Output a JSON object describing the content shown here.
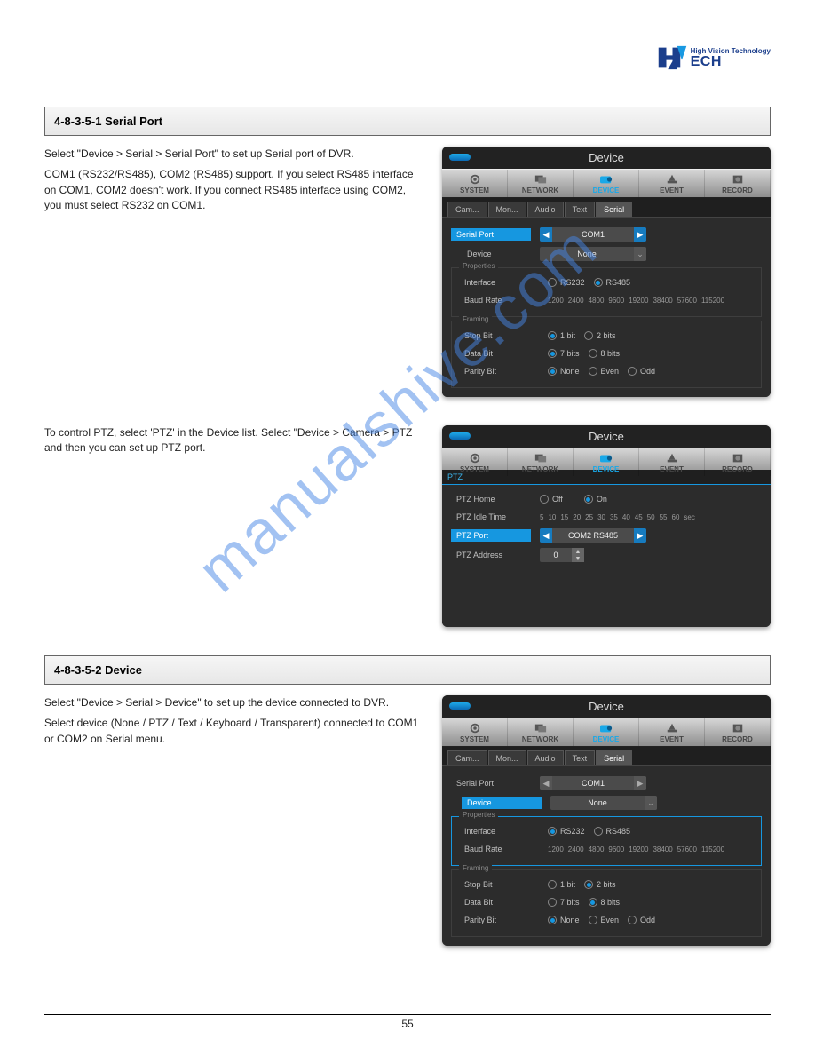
{
  "logo": {
    "tagline": "High Vision Technology",
    "brand": "ECH"
  },
  "section1": {
    "title": "4-8-3-5-1 Serial Port",
    "para1": "Select \"Device > Serial > Serial Port\" to set up Serial port of DVR.",
    "para2": "COM1 (RS232/RS485), COM2 (RS485) support. If you select RS485 interface on COM1, COM2 doesn't work. If you connect RS485 interface using COM2, you must select RS232 on COM1.",
    "para3": "To control PTZ, select 'PTZ' in the Device list. Select \"Device > Camera > PTZ and then you can set up PTZ port."
  },
  "section2": {
    "title": "4-8-3-5-2 Device",
    "para1": "Select \"Device > Serial > Device\" to set up the device connected to DVR.",
    "para2": "Select device (None / PTZ / Text / Keyboard / Transparent) connected to COM1 or COM2 on Serial menu."
  },
  "panel": {
    "title": "Device",
    "nav": [
      "SYSTEM",
      "NETWORK",
      "DEVICE",
      "EVENT",
      "RECORD"
    ],
    "tabs": [
      "Cam...",
      "Mon...",
      "Audio",
      "Text",
      "Serial"
    ],
    "serial": {
      "serialPortLabel": "Serial Port",
      "serialPortValue": "COM1",
      "deviceLabel": "Device",
      "deviceValue": "None",
      "propertiesLabel": "Properties",
      "interfaceLabel": "Interface",
      "interfaceOptions": [
        "RS232",
        "RS485"
      ],
      "baudLabel": "Baud Rate",
      "baudTicks": [
        "1200",
        "2400",
        "4800",
        "9600",
        "19200",
        "38400",
        "57600",
        "115200"
      ],
      "framingLabel": "Framing",
      "stopBitLabel": "Stop Bit",
      "stopBitOptions": [
        "1 bit",
        "2 bits"
      ],
      "dataBitLabel": "Data Bit",
      "dataBitOptions": [
        "7 bits",
        "8 bits"
      ],
      "parityLabel": "Parity Bit",
      "parityOptions": [
        "None",
        "Even",
        "Odd"
      ]
    },
    "ptz": {
      "head": "PTZ",
      "homeLabel": "PTZ Home",
      "homeOptions": [
        "Off",
        "On"
      ],
      "idleLabel": "PTZ Idle Time",
      "idleTicks": [
        "5",
        "10",
        "15",
        "20",
        "25",
        "30",
        "35",
        "40",
        "45",
        "50",
        "55",
        "60"
      ],
      "idleUnit": "sec",
      "portLabel": "PTZ Port",
      "portValue": "COM2 RS485",
      "addrLabel": "PTZ Address",
      "addrValue": "0"
    }
  },
  "footer": "55",
  "watermark": "manualshive.com"
}
